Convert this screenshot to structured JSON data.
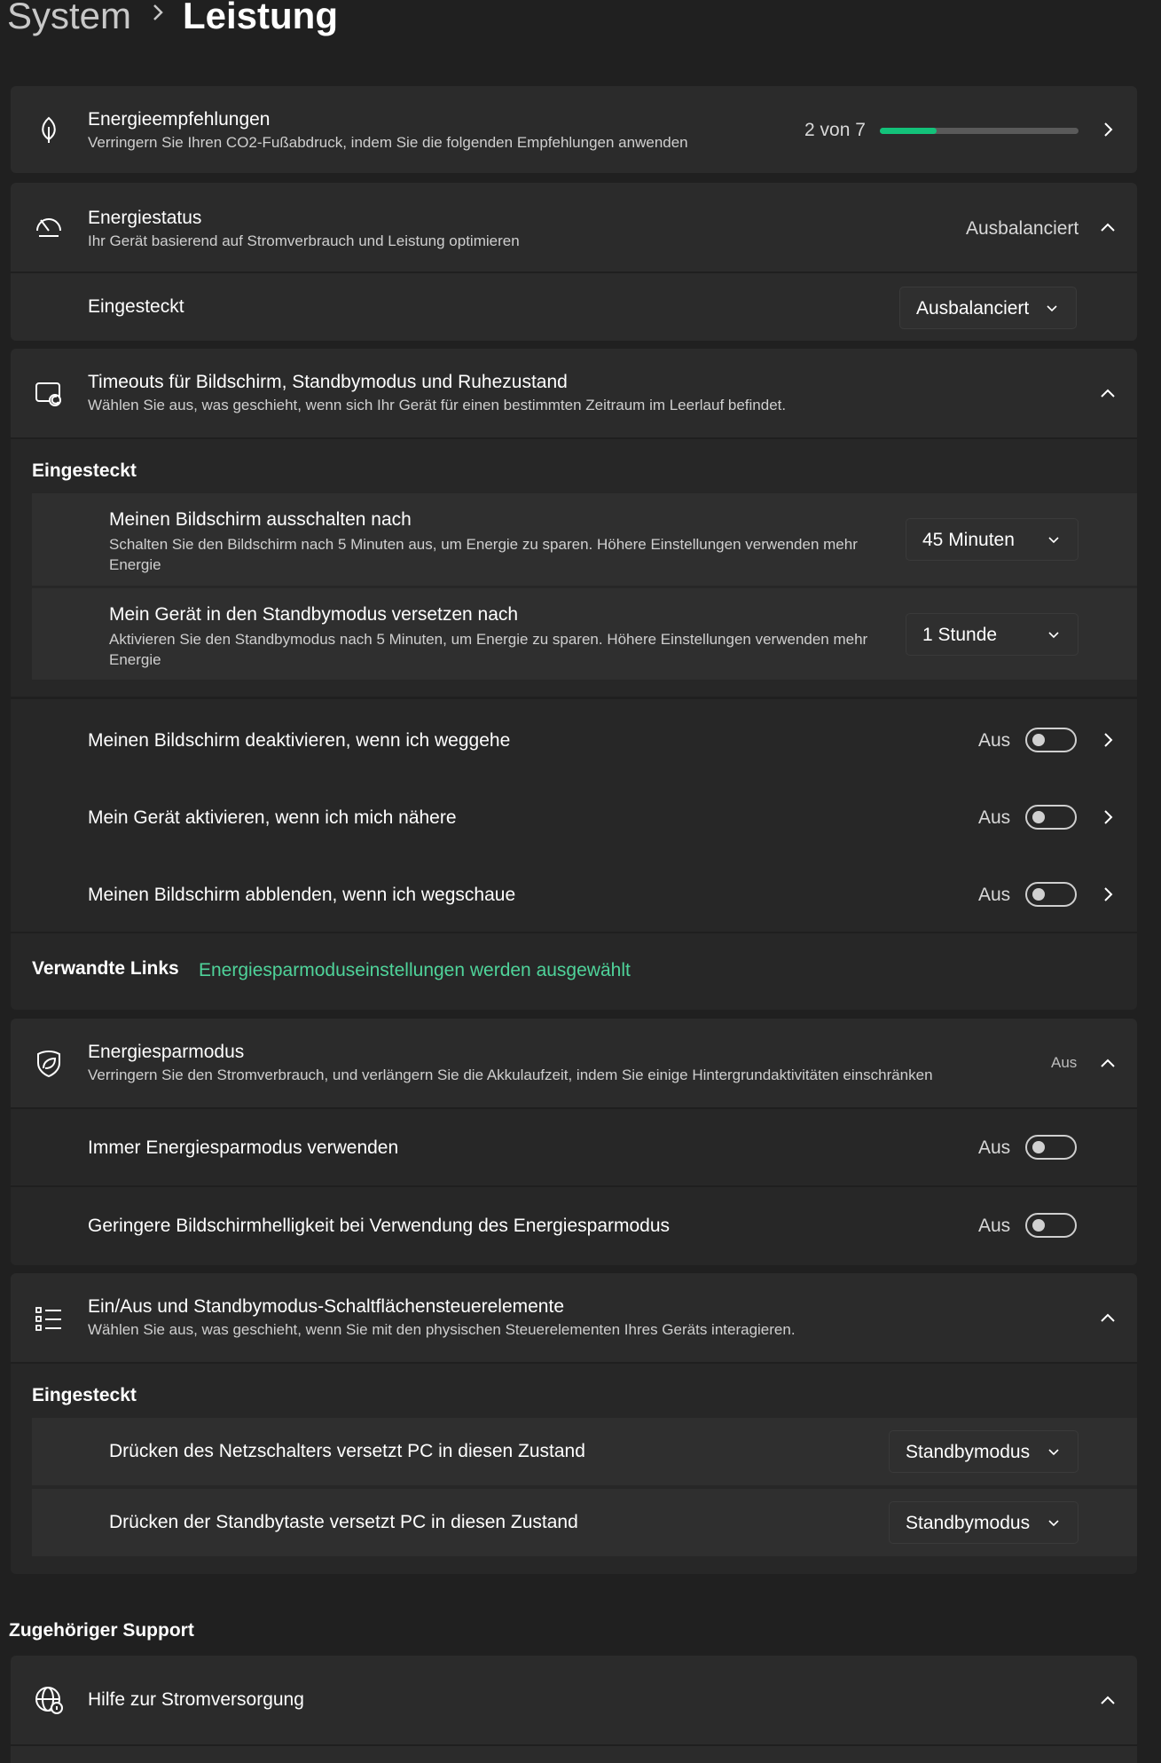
{
  "breadcrumb": {
    "parent": "System",
    "current": "Leistung"
  },
  "recommendations": {
    "title": "Energieempfehlungen",
    "subtitle": "Verringern Sie Ihren CO2-Fußabdruck, indem Sie die folgenden Empfehlungen anwenden",
    "progress_text": "2 von 7",
    "progress_fraction": 0.2857,
    "icon": "leaf-icon"
  },
  "power_mode": {
    "title": "Energiestatus",
    "subtitle": "Ihr Gerät basierend auf Stromverbrauch und Leistung optimieren",
    "value": "Ausbalanciert",
    "icon": "speedometer-icon",
    "plugged_label": "Eingesteckt",
    "plugged_value": "Ausbalanciert"
  },
  "timeouts": {
    "title": "Timeouts für Bildschirm, Standbymodus und Ruhezustand",
    "subtitle": "Wählen Sie aus, was geschieht, wenn sich Ihr Gerät für einen bestimmten Zeitraum im Leerlauf befindet.",
    "icon": "screen-moon-icon",
    "group_label": "Eingesteckt",
    "screen_off": {
      "title": "Meinen Bildschirm ausschalten nach",
      "subtitle": "Schalten Sie den Bildschirm nach 5 Minuten aus, um Energie zu sparen. Höhere Einstellungen verwenden mehr Energie",
      "value": "45 Minuten"
    },
    "sleep": {
      "title": "Mein Gerät in den Standbymodus versetzen nach",
      "subtitle": "Aktivieren Sie den Standbymodus nach 5 Minuten, um Energie zu sparen. Höhere Einstellungen verwenden mehr Energie",
      "value": "1 Stunde"
    },
    "presence": [
      {
        "title": "Meinen Bildschirm deaktivieren, wenn ich weggehe",
        "state": "Aus"
      },
      {
        "title": "Mein Gerät aktivieren, wenn ich mich nähere",
        "state": "Aus"
      },
      {
        "title": "Meinen Bildschirm abblenden, wenn ich wegschaue",
        "state": "Aus"
      }
    ],
    "related_label": "Verwandte Links",
    "related_link": "Energiesparmoduseinstellungen werden ausgewählt"
  },
  "saver": {
    "title": "Energiesparmodus",
    "subtitle": "Verringern Sie den Stromverbrauch, und verlängern Sie die Akkulaufzeit, indem Sie einige Hintergrundaktivitäten einschränken",
    "value": "Aus",
    "icon": "leaf-shield-icon",
    "always": {
      "title": "Immer Energiesparmodus verwenden",
      "state": "Aus"
    },
    "brightness": {
      "title": "Geringere Bildschirmhelligkeit bei Verwendung des Energiesparmodus",
      "state": "Aus"
    }
  },
  "buttons": {
    "title": "Ein/Aus und Standbymodus-Schaltflächensteuerelemente",
    "subtitle": "Wählen Sie aus, was geschieht, wenn Sie mit den physischen Steuerelementen Ihres Geräts interagieren.",
    "icon": "list-icon",
    "group_label": "Eingesteckt",
    "power_button": {
      "title": "Drücken des Netzschalters versetzt PC in diesen Zustand",
      "value": "Standbymodus"
    },
    "sleep_button": {
      "title": "Drücken der Standbytaste versetzt PC in diesen Zustand",
      "value": "Standbymodus"
    }
  },
  "support": {
    "heading": "Zugehöriger Support",
    "help": {
      "title": "Hilfe zur Stromversorgung",
      "icon": "globe-icon"
    }
  },
  "colors": {
    "accent": "#13c27a",
    "link": "#4fd39a",
    "background": "#202020",
    "card": "#2b2b2b"
  }
}
